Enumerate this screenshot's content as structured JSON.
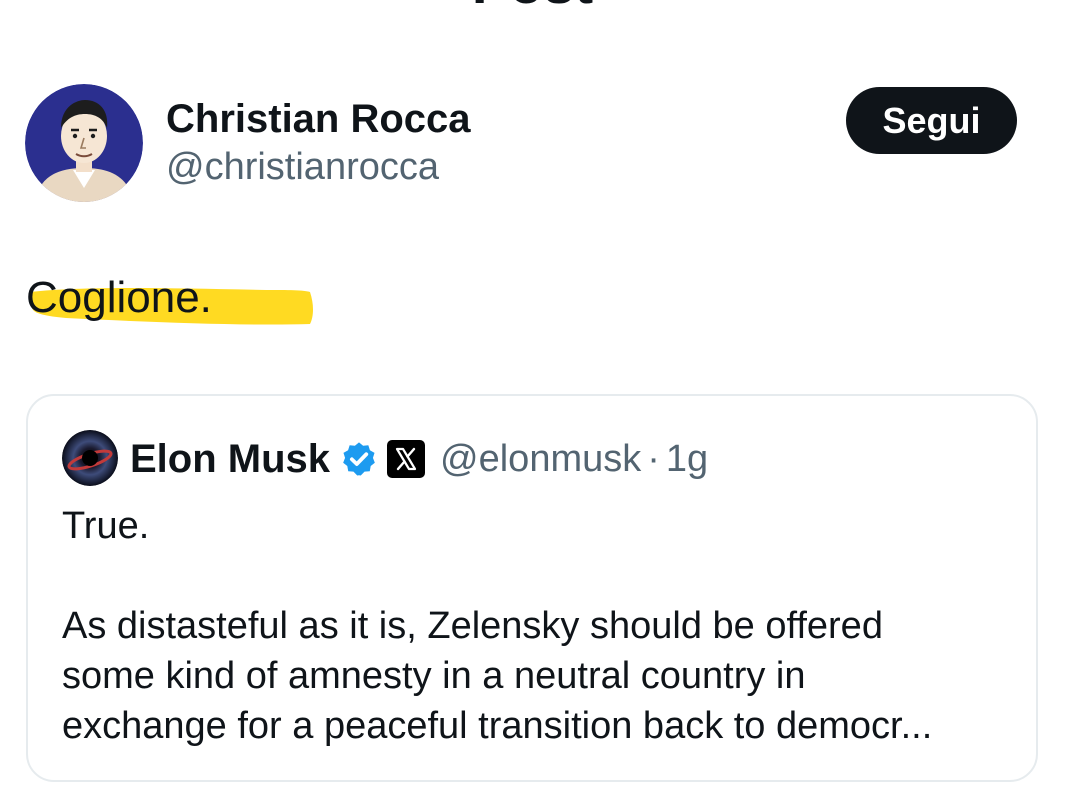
{
  "header": {
    "title": "Post",
    "back_icon": "arrow-left-icon"
  },
  "author": {
    "name": "Christian Rocca",
    "handle": "@christianrocca",
    "avatar_icon": "illustrated-portrait-avatar",
    "follow_label": "Segui"
  },
  "post": {
    "text": "Coglione.",
    "highlight_color": "#ffd60a"
  },
  "quoted": {
    "name": "Elon Musk",
    "handle": "@elonmusk",
    "separator": "·",
    "time": "1g",
    "verified_icon": "verified-badge-icon",
    "affiliate_icon": "x-logo-icon",
    "body_lines": [
      "True.",
      "As distasteful as it is, Zelensky should be offered",
      "some kind of amnesty in a neutral country in",
      "exchange for a peaceful transition back to democr..."
    ]
  },
  "colors": {
    "text_primary": "#0f1419",
    "text_secondary": "#536471",
    "button_bg": "#0f1419",
    "verified_blue": "#1d9bf0",
    "card_border": "#e6ebee"
  }
}
